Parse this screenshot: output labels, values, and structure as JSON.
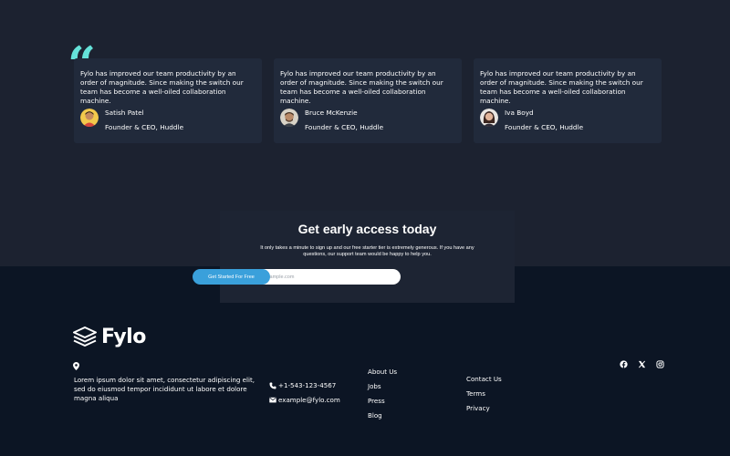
{
  "testimonials": [
    {
      "text": "Fylo has improved our team productivity by an order of magnitude. Since making the switch our team has become a well-oiled collaboration machine.",
      "name": "Satish Patel",
      "role": "Founder & CEO, Huddle"
    },
    {
      "text": "Fylo has improved our team productivity by an order of magnitude. Since making the switch our team has become a well-oiled collaboration machine.",
      "name": "Bruce McKenzie",
      "role": "Founder & CEO, Huddle"
    },
    {
      "text": "Fylo has improved our team productivity by an order of magnitude. Since making the switch our team has become a well-oiled collaboration machine.",
      "name": "Iva Boyd",
      "role": "Founder & CEO, Huddle"
    }
  ],
  "cta": {
    "title": "Get early access today",
    "text": "It only takes a minute to sign up and our free starter tier is extremely generous. If you have any questions, our support team would be happy to help you.",
    "email_placeholder": "email@example.com",
    "button_label": "Get Started For Free"
  },
  "footer": {
    "logo_text": "Fylo",
    "address": "Lorem ipsum dolor sit amet, consectetur adipiscing elit, sed do eiusmod tempor incididunt ut labore et dolore magna aliqua",
    "phone": "+1-543-123-4567",
    "email": "example@fylo.com",
    "links_col1": [
      "About Us",
      "Jobs",
      "Press",
      "Blog"
    ],
    "links_col2": [
      "Contact Us",
      "Terms",
      "Privacy"
    ],
    "social": [
      "facebook-icon",
      "x-icon",
      "instagram-icon"
    ]
  },
  "colors": {
    "accent_quote": "#65e2d9",
    "button": "#3aa0db",
    "top_background": "#1c2230",
    "footer_background": "#0c1524",
    "card_background": "#212a3b"
  }
}
